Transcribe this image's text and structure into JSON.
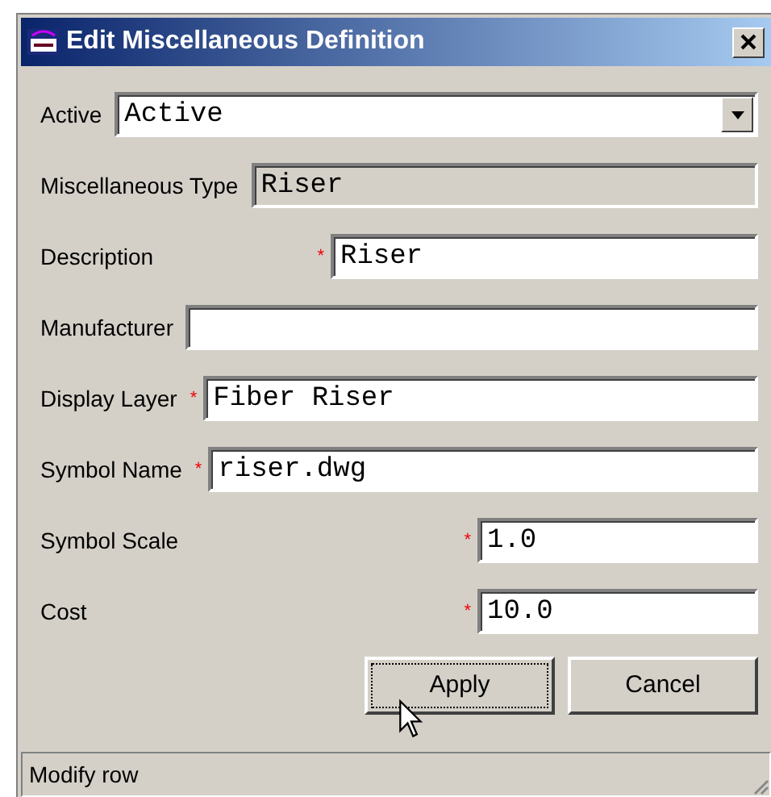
{
  "window": {
    "title": "Edit Miscellaneous Definition"
  },
  "fields": [
    {
      "label": "Active",
      "kind": "dropdown",
      "value": "Active"
    },
    {
      "label": "Miscellaneous Type",
      "kind": "readonly",
      "value": "Riser"
    },
    {
      "label": "Description",
      "kind": "text",
      "value": "Riser",
      "required_mark": "*"
    },
    {
      "label": "Manufacturer",
      "kind": "text"
    },
    {
      "label": "Display Layer",
      "kind": "text",
      "value": "Fiber Riser",
      "required_mark": "*"
    },
    {
      "label": "Symbol Name",
      "kind": "text",
      "value": "riser.dwg",
      "required_mark": "*"
    },
    {
      "label": "Symbol Scale",
      "kind": "number",
      "value": "1.0",
      "required_mark": "*"
    },
    {
      "label": "Cost",
      "kind": "number",
      "value": "10.0",
      "required_mark": "*"
    }
  ],
  "buttons": [
    {
      "label": "Apply",
      "focused": true
    },
    {
      "label": "Cancel",
      "focused": false
    }
  ],
  "status_bar": "Modify row"
}
